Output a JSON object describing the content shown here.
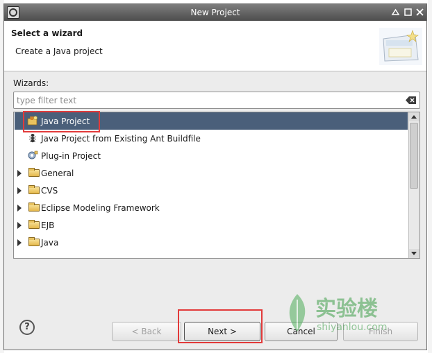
{
  "window": {
    "title": "New Project"
  },
  "header": {
    "title": "Select a wizard",
    "description": "Create a Java project"
  },
  "wizards_label": "Wizards:",
  "filter": {
    "placeholder": "type filter text",
    "value": ""
  },
  "tree": {
    "items": [
      {
        "label": "Java Project",
        "icon": "java-project-icon",
        "selected": true,
        "expandable": false
      },
      {
        "label": "Java Project from Existing Ant Buildfile",
        "icon": "ant-icon",
        "selected": false,
        "expandable": false
      },
      {
        "label": "Plug-in Project",
        "icon": "plugin-icon",
        "selected": false,
        "expandable": false
      },
      {
        "label": "General",
        "icon": "folder-icon",
        "selected": false,
        "expandable": true
      },
      {
        "label": "CVS",
        "icon": "folder-icon",
        "selected": false,
        "expandable": true
      },
      {
        "label": "Eclipse Modeling Framework",
        "icon": "folder-icon",
        "selected": false,
        "expandable": true
      },
      {
        "label": "EJB",
        "icon": "folder-icon",
        "selected": false,
        "expandable": true
      },
      {
        "label": "Java",
        "icon": "folder-icon",
        "selected": false,
        "expandable": true
      }
    ]
  },
  "buttons": {
    "back": "< Back",
    "next": "Next >",
    "cancel": "Cancel",
    "finish": "Finish"
  },
  "watermark": {
    "text": "实验楼",
    "subtext": "shiyanlou.com"
  },
  "colors": {
    "selection": "#4a5f7a",
    "highlight": "#e23a3a",
    "titlebar": "#5a5a5a"
  }
}
